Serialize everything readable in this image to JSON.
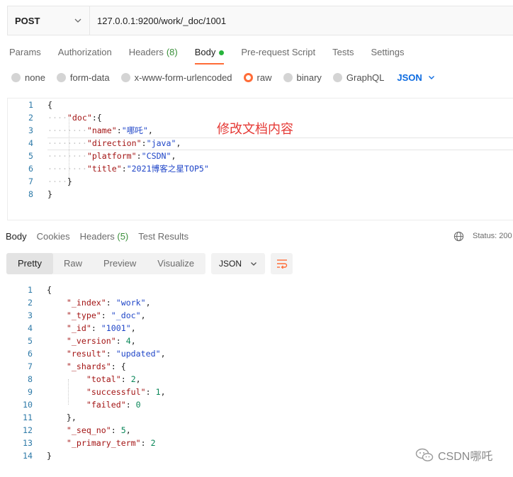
{
  "request": {
    "method": "POST",
    "url": "127.0.0.1:9200/work/_doc/1001"
  },
  "request_tabs": [
    {
      "label": "Params"
    },
    {
      "label": "Authorization"
    },
    {
      "label": "Headers",
      "count": "(8)"
    },
    {
      "label": "Body",
      "active": true
    },
    {
      "label": "Pre-request Script"
    },
    {
      "label": "Tests"
    },
    {
      "label": "Settings"
    }
  ],
  "body_types": {
    "options": [
      "none",
      "form-data",
      "x-www-form-urlencoded",
      "raw",
      "binary",
      "GraphQL"
    ],
    "selected": "raw",
    "format": "JSON"
  },
  "request_body": {
    "line_numbers": [
      "1",
      "2",
      "3",
      "4",
      "5",
      "6",
      "7",
      "8"
    ],
    "doc_key": "\"doc\"",
    "fields": [
      {
        "key": "\"name\"",
        "value": "\"哪吒\""
      },
      {
        "key": "\"direction\"",
        "value": "\"java\""
      },
      {
        "key": "\"platform\"",
        "value": "\"CSDN\""
      },
      {
        "key": "\"title\"",
        "value": "\"2021博客之星TOP5\""
      }
    ]
  },
  "annotation": "修改文档内容",
  "response_tabs": {
    "body": "Body",
    "cookies": "Cookies",
    "headers": "Headers",
    "headers_count": "(5)",
    "test_results": "Test Results"
  },
  "status_label": "Status: 200",
  "view_modes": [
    "Pretty",
    "Raw",
    "Preview",
    "Visualize"
  ],
  "view_format": "JSON",
  "response_body": {
    "line_numbers": [
      "1",
      "2",
      "3",
      "4",
      "5",
      "6",
      "7",
      "8",
      "9",
      "10",
      "11",
      "12",
      "13",
      "14"
    ],
    "fields": [
      {
        "key": "\"_index\"",
        "value": "\"work\""
      },
      {
        "key": "\"_type\"",
        "value": "\"_doc\""
      },
      {
        "key": "\"_id\"",
        "value": "\"1001\""
      },
      {
        "key": "\"_version\"",
        "value": "4"
      },
      {
        "key": "\"result\"",
        "value": "\"updated\""
      }
    ],
    "shards_key": "\"_shards\"",
    "shards": [
      {
        "key": "\"total\"",
        "value": "2"
      },
      {
        "key": "\"successful\"",
        "value": "1"
      },
      {
        "key": "\"failed\"",
        "value": "0"
      }
    ],
    "tail": [
      {
        "key": "\"_seq_no\"",
        "value": "5"
      },
      {
        "key": "\"_primary_term\"",
        "value": "2"
      }
    ]
  },
  "watermark": "CSDN哪吒",
  "colors": {
    "accent": "#ff6c37",
    "link": "#0d6be0",
    "count": "#3a8f3a",
    "annotation": "#e53935"
  }
}
